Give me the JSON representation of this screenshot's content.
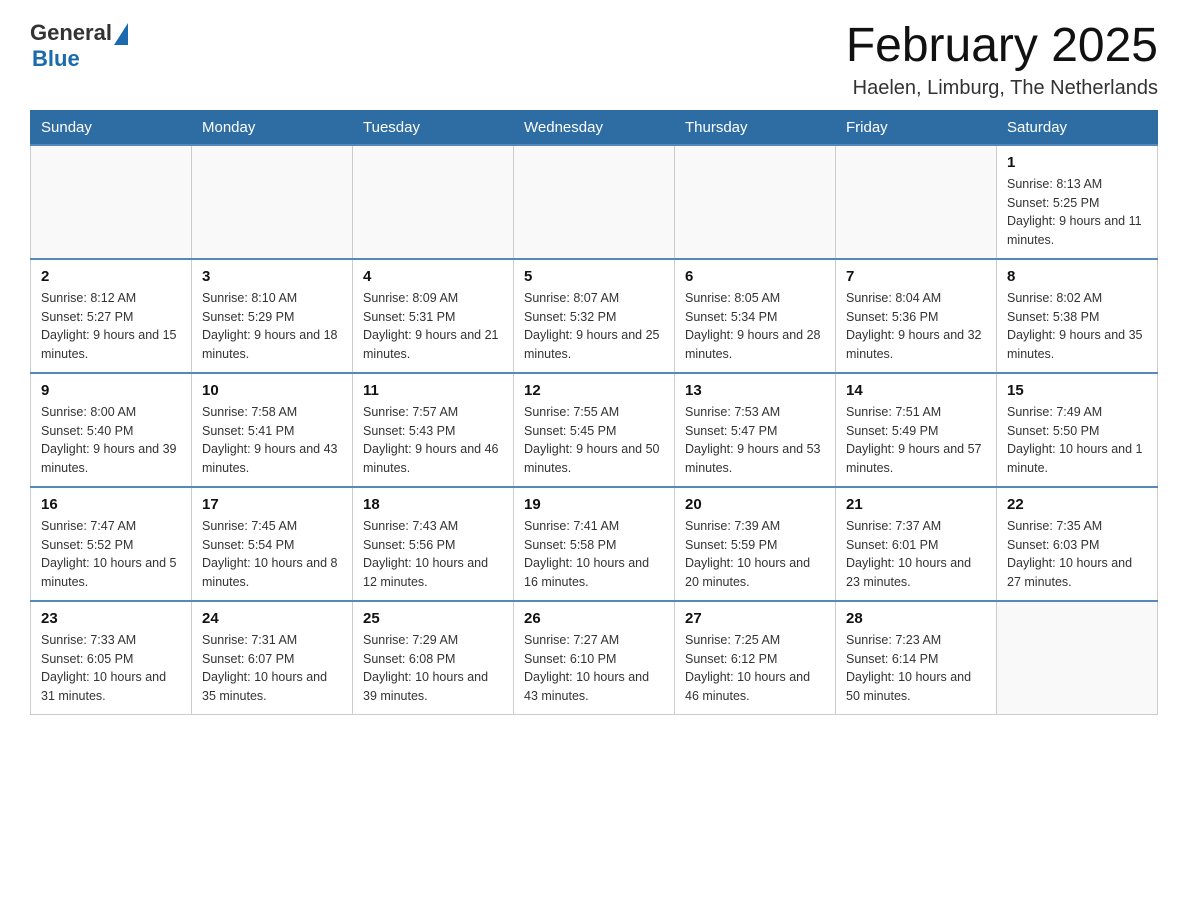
{
  "header": {
    "logo": {
      "general": "General",
      "blue": "Blue"
    },
    "title": "February 2025",
    "subtitle": "Haelen, Limburg, The Netherlands"
  },
  "days_of_week": [
    "Sunday",
    "Monday",
    "Tuesday",
    "Wednesday",
    "Thursday",
    "Friday",
    "Saturday"
  ],
  "weeks": [
    [
      {
        "day": "",
        "info": ""
      },
      {
        "day": "",
        "info": ""
      },
      {
        "day": "",
        "info": ""
      },
      {
        "day": "",
        "info": ""
      },
      {
        "day": "",
        "info": ""
      },
      {
        "day": "",
        "info": ""
      },
      {
        "day": "1",
        "info": "Sunrise: 8:13 AM\nSunset: 5:25 PM\nDaylight: 9 hours and 11 minutes."
      }
    ],
    [
      {
        "day": "2",
        "info": "Sunrise: 8:12 AM\nSunset: 5:27 PM\nDaylight: 9 hours and 15 minutes."
      },
      {
        "day": "3",
        "info": "Sunrise: 8:10 AM\nSunset: 5:29 PM\nDaylight: 9 hours and 18 minutes."
      },
      {
        "day": "4",
        "info": "Sunrise: 8:09 AM\nSunset: 5:31 PM\nDaylight: 9 hours and 21 minutes."
      },
      {
        "day": "5",
        "info": "Sunrise: 8:07 AM\nSunset: 5:32 PM\nDaylight: 9 hours and 25 minutes."
      },
      {
        "day": "6",
        "info": "Sunrise: 8:05 AM\nSunset: 5:34 PM\nDaylight: 9 hours and 28 minutes."
      },
      {
        "day": "7",
        "info": "Sunrise: 8:04 AM\nSunset: 5:36 PM\nDaylight: 9 hours and 32 minutes."
      },
      {
        "day": "8",
        "info": "Sunrise: 8:02 AM\nSunset: 5:38 PM\nDaylight: 9 hours and 35 minutes."
      }
    ],
    [
      {
        "day": "9",
        "info": "Sunrise: 8:00 AM\nSunset: 5:40 PM\nDaylight: 9 hours and 39 minutes."
      },
      {
        "day": "10",
        "info": "Sunrise: 7:58 AM\nSunset: 5:41 PM\nDaylight: 9 hours and 43 minutes."
      },
      {
        "day": "11",
        "info": "Sunrise: 7:57 AM\nSunset: 5:43 PM\nDaylight: 9 hours and 46 minutes."
      },
      {
        "day": "12",
        "info": "Sunrise: 7:55 AM\nSunset: 5:45 PM\nDaylight: 9 hours and 50 minutes."
      },
      {
        "day": "13",
        "info": "Sunrise: 7:53 AM\nSunset: 5:47 PM\nDaylight: 9 hours and 53 minutes."
      },
      {
        "day": "14",
        "info": "Sunrise: 7:51 AM\nSunset: 5:49 PM\nDaylight: 9 hours and 57 minutes."
      },
      {
        "day": "15",
        "info": "Sunrise: 7:49 AM\nSunset: 5:50 PM\nDaylight: 10 hours and 1 minute."
      }
    ],
    [
      {
        "day": "16",
        "info": "Sunrise: 7:47 AM\nSunset: 5:52 PM\nDaylight: 10 hours and 5 minutes."
      },
      {
        "day": "17",
        "info": "Sunrise: 7:45 AM\nSunset: 5:54 PM\nDaylight: 10 hours and 8 minutes."
      },
      {
        "day": "18",
        "info": "Sunrise: 7:43 AM\nSunset: 5:56 PM\nDaylight: 10 hours and 12 minutes."
      },
      {
        "day": "19",
        "info": "Sunrise: 7:41 AM\nSunset: 5:58 PM\nDaylight: 10 hours and 16 minutes."
      },
      {
        "day": "20",
        "info": "Sunrise: 7:39 AM\nSunset: 5:59 PM\nDaylight: 10 hours and 20 minutes."
      },
      {
        "day": "21",
        "info": "Sunrise: 7:37 AM\nSunset: 6:01 PM\nDaylight: 10 hours and 23 minutes."
      },
      {
        "day": "22",
        "info": "Sunrise: 7:35 AM\nSunset: 6:03 PM\nDaylight: 10 hours and 27 minutes."
      }
    ],
    [
      {
        "day": "23",
        "info": "Sunrise: 7:33 AM\nSunset: 6:05 PM\nDaylight: 10 hours and 31 minutes."
      },
      {
        "day": "24",
        "info": "Sunrise: 7:31 AM\nSunset: 6:07 PM\nDaylight: 10 hours and 35 minutes."
      },
      {
        "day": "25",
        "info": "Sunrise: 7:29 AM\nSunset: 6:08 PM\nDaylight: 10 hours and 39 minutes."
      },
      {
        "day": "26",
        "info": "Sunrise: 7:27 AM\nSunset: 6:10 PM\nDaylight: 10 hours and 43 minutes."
      },
      {
        "day": "27",
        "info": "Sunrise: 7:25 AM\nSunset: 6:12 PM\nDaylight: 10 hours and 46 minutes."
      },
      {
        "day": "28",
        "info": "Sunrise: 7:23 AM\nSunset: 6:14 PM\nDaylight: 10 hours and 50 minutes."
      },
      {
        "day": "",
        "info": ""
      }
    ]
  ]
}
